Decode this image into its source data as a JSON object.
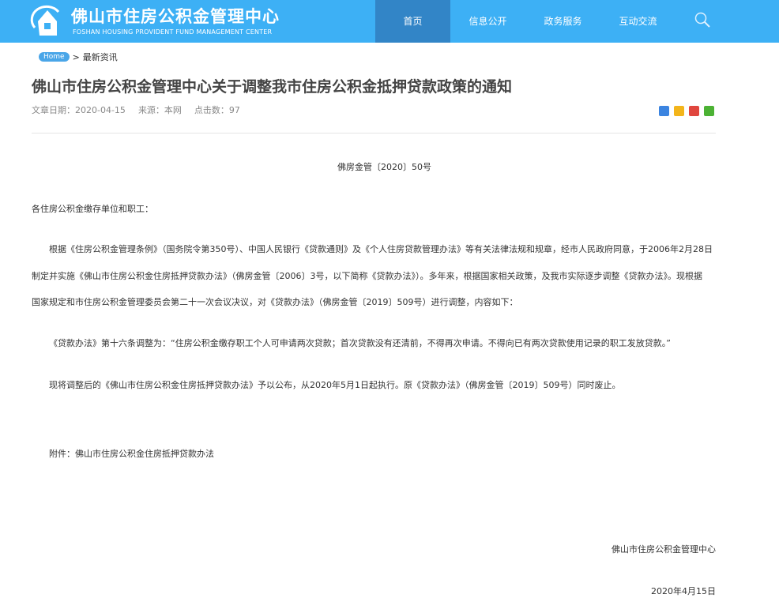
{
  "header": {
    "title_cn": "佛山市住房公积金管理中心",
    "title_en": "FOSHAN HOUSING PROVIDENT FUND MANAGEMENT CENTER",
    "nav": [
      "首页",
      "信息公开",
      "政务服务",
      "互动交流"
    ]
  },
  "breadcrumb": {
    "home": "Home",
    "sep": ">",
    "current": "最新资讯"
  },
  "article": {
    "title": "佛山市住房公积金管理中心关于调整我市住房公积金抵押贷款政策的通知",
    "date": "文章日期：2020-04-15",
    "source": "来源：本网",
    "clicks": "点击数：97",
    "doc_no": "佛房金管〔2020〕50号",
    "salutation": "各住房公积金缴存单位和职工：",
    "p1": [
      "根据《住房公积金管理条例》（国务院令第350号）、中国人民银行《贷款通则》及《个人住房贷款管理办法》等有关法律法规和规章，经市人民政府同意，于2006年2月28日",
      "制定并实施《佛山市住房公积金住房抵押贷款办法》（佛房金管〔2006〕3号，以下简称《贷款办法》）。多年来，根据国家相关政策，及我市实际逐步调整《贷款办法》。现根据",
      "国家规定和市住房公积金管理委员会第二十一次会议决议，对《贷款办法》（佛房金管〔2019〕509号）进行调整，内容如下："
    ],
    "p2": "《贷款办法》第十六条调整为：“住房公积金缴存职工个人可申请两次贷款；首次贷款没有还清前，不得再次申请。不得向已有两次贷款使用记录的职工发放贷款。”",
    "p3": "现将调整后的《佛山市住房公积金住房抵押贷款办法》予以公布，从2020年5月1日起执行。原《贷款办法》（佛房金管〔2019〕509号）同时废止。",
    "attachment": "附件：佛山市住房公积金住房抵押贷款办法",
    "signer": "佛山市住房公积金管理中心",
    "sign_date": "2020年4月15日"
  }
}
